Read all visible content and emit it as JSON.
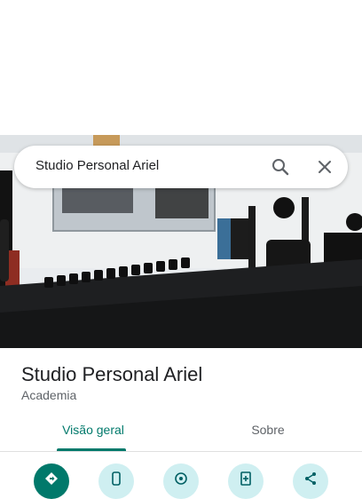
{
  "search": {
    "query": "Studio Personal Ariel"
  },
  "place": {
    "name": "Studio Personal Ariel",
    "category": "Academia"
  },
  "tabs": [
    {
      "label": "Visão geral",
      "selected": true
    },
    {
      "label": "Sobre",
      "selected": false
    }
  ],
  "actions": [
    {
      "icon": "directions-icon"
    },
    {
      "icon": "phone-icon"
    },
    {
      "icon": "location-icon"
    },
    {
      "icon": "save-icon"
    },
    {
      "icon": "share-icon"
    }
  ],
  "colors": {
    "accent": "#00796b",
    "chip_bg": "#cfeff1"
  }
}
